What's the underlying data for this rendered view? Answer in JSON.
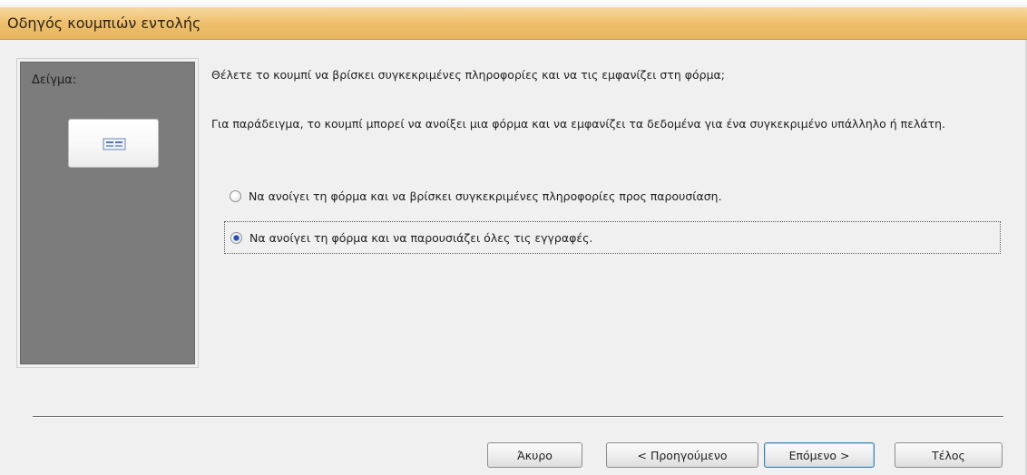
{
  "window": {
    "title": "Οδηγός κουμπιών εντολής"
  },
  "sample_panel": {
    "label": "Δείγμα:",
    "preview_icon": "form-button-icon"
  },
  "content": {
    "question": "Θέλετε το κουμπί να βρίσκει συγκεκριμένες πληροφορίες και να τις εμφανίζει στη φόρμα;",
    "example": "Για παράδειγμα, το κουμπί μπορεί να ανοίξει μια φόρμα και να εμφανίζει τα δεδομένα για ένα συγκεκριμένο υπάλληλο ή πελάτη."
  },
  "options": [
    {
      "label": "Να ανοίγει τη φόρμα και να βρίσκει συγκεκριμένες πληροφορίες προς παρουσίαση.",
      "selected": false
    },
    {
      "label": "Να ανοίγει τη φόρμα και να παρουσιάζει όλες τις εγγραφές.",
      "selected": true
    }
  ],
  "buttons": {
    "cancel": "Άκυρο",
    "previous": "< Προηγούμενο",
    "next": "Επόμενο >",
    "finish": "Τέλος"
  },
  "colors": {
    "title_accent": "#efc06d",
    "selected_radio": "#1e4aa8",
    "sample_panel": "#7c7c7c"
  }
}
